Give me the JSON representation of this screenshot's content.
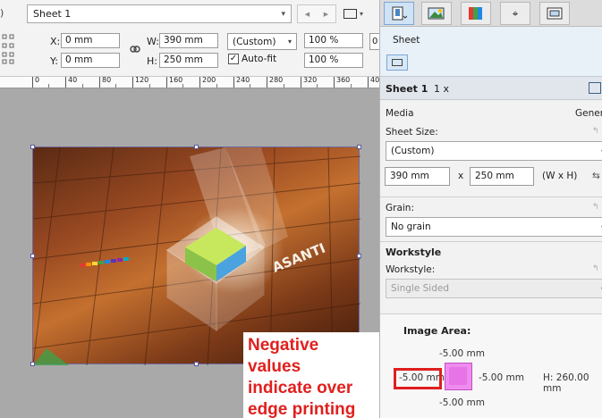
{
  "toolbar": {
    "paren": ")",
    "sheet_select": "Sheet 1",
    "x_label": "X:",
    "x_value": "0 mm",
    "y_label": "Y:",
    "y_value": "0 mm",
    "w_label": "W:",
    "w_value": "390 mm",
    "h_label": "H:",
    "h_value": "250 mm",
    "size_preset": "(Custom)",
    "scale_w": "100 %",
    "scale_h": "100 %",
    "autofit_label": "Auto-fit",
    "autofit_checked": true,
    "edge_frag": "0"
  },
  "ruler": {
    "ticks": [
      "0",
      "40",
      "80",
      "120",
      "160",
      "200",
      "240",
      "280",
      "320",
      "360",
      "40"
    ]
  },
  "artwork": {
    "logo_text": "ASANTI"
  },
  "callout": {
    "line1": "Negative values",
    "line2": "indicate over",
    "line3": "edge printing"
  },
  "panel": {
    "tab_label": "Sheet",
    "header_title": "Sheet 1",
    "header_count": "1 x",
    "media_label": "Media",
    "general_label": "Gener",
    "sheet_size_label": "Sheet Size:",
    "sheet_size_value": "(Custom)",
    "width_value": "390 mm",
    "x_sep": "x",
    "height_value": "250 mm",
    "wxh_label": "(W x H)",
    "grain_label": "Grain:",
    "grain_value": "No grain",
    "workstyle_section": "Workstyle",
    "workstyle_label": "Workstyle:",
    "workstyle_value": "Single Sided",
    "image_area_label": "Image Area:",
    "top_margin": "-5.00 mm",
    "left_margin": "-5.00 mm",
    "right_margin": "-5.00 mm",
    "bottom_margin": "-5.00 mm",
    "height_readout": "H: 260.00 mm",
    "highlight_color": "#e01e1e",
    "margin_box_color": "#ef8cef"
  }
}
